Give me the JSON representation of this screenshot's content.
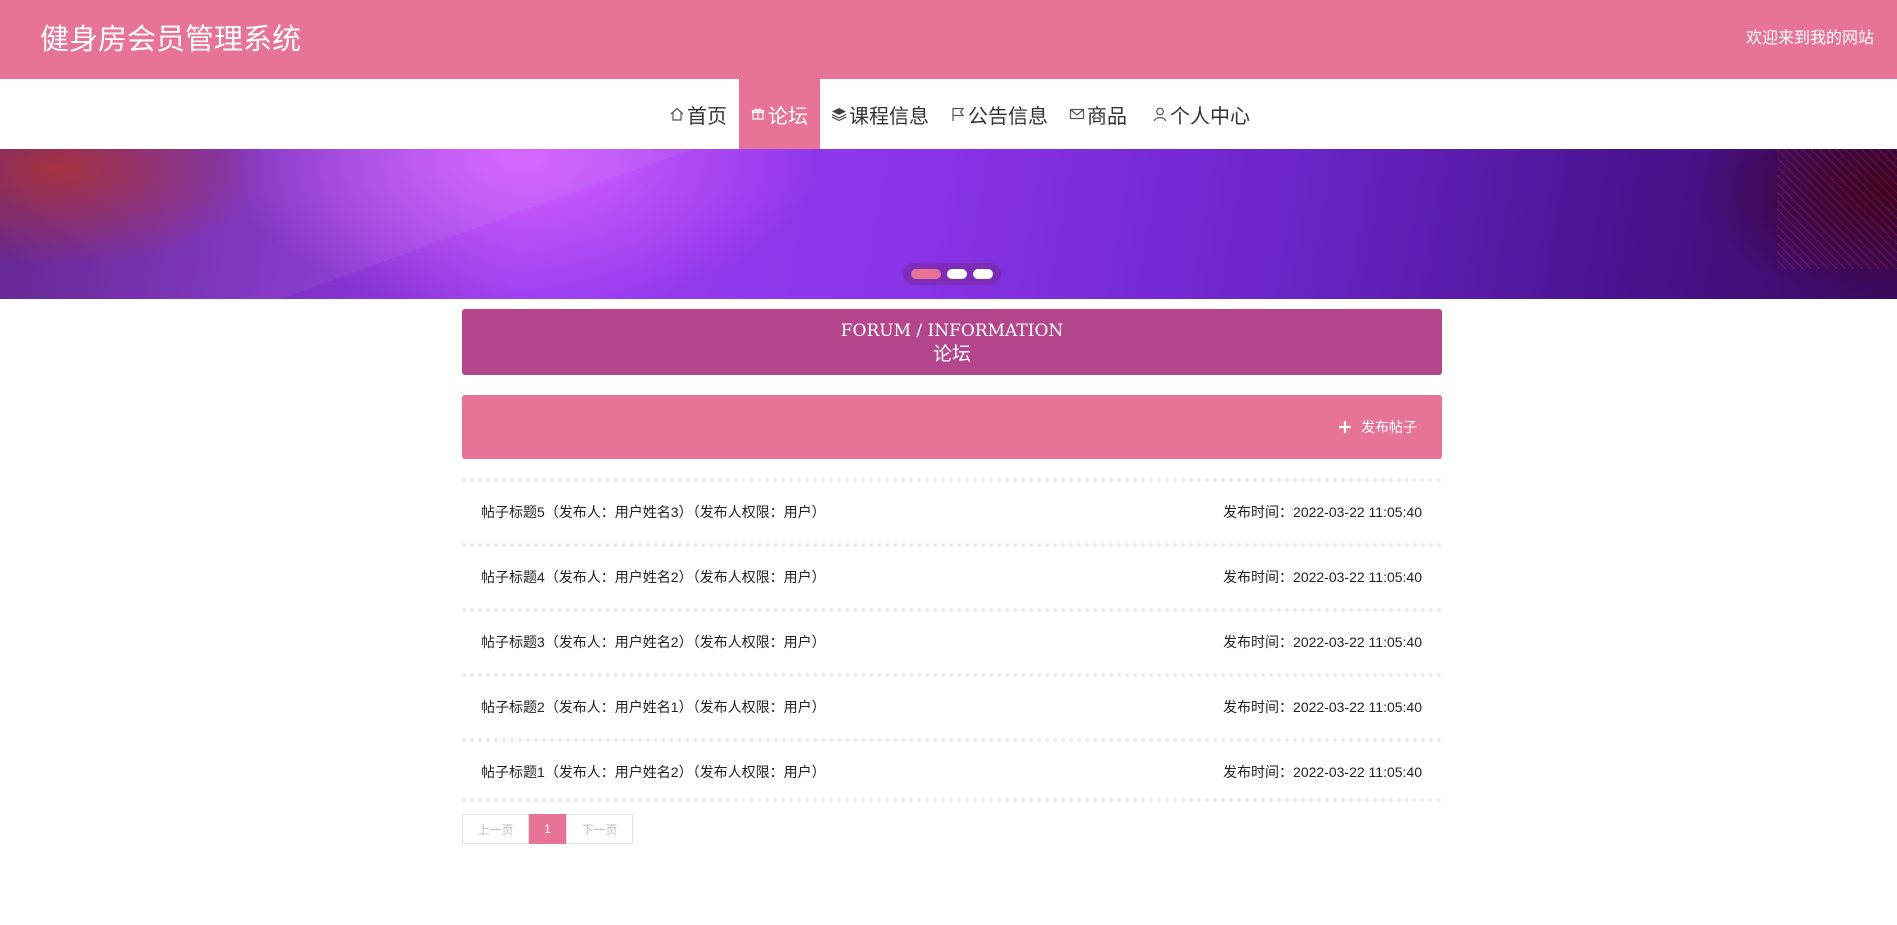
{
  "header": {
    "site_title": "健身房会员管理系统",
    "welcome": "欢迎来到我的网站",
    "bg_color": "#e77496"
  },
  "nav": {
    "items": [
      {
        "label": "首页",
        "icon": "home-icon",
        "active": false
      },
      {
        "label": "论坛",
        "icon": "gift-icon",
        "active": true
      },
      {
        "label": "课程信息",
        "icon": "layers-icon",
        "active": false
      },
      {
        "label": "公告信息",
        "icon": "flag-icon",
        "active": false
      },
      {
        "label": "商品",
        "icon": "mail-icon",
        "active": false
      },
      {
        "label": "个人中心",
        "icon": "user-icon",
        "active": false
      }
    ]
  },
  "banner": {
    "slide_count": 3,
    "active_slide": 1
  },
  "section": {
    "title_en": "FORUM / INFORMATION",
    "title_cn": "论坛",
    "bg_color": "#b4468e"
  },
  "actions": {
    "post_label": "发布帖子"
  },
  "posts": [
    {
      "title": "帖子标题5（发布人：用户姓名3）（发布人权限：用户）",
      "time": "发布时间：2022-03-22 11:05:40"
    },
    {
      "title": "帖子标题4（发布人：用户姓名2）（发布人权限：用户）",
      "time": "发布时间：2022-03-22 11:05:40"
    },
    {
      "title": "帖子标题3（发布人：用户姓名2）（发布人权限：用户）",
      "time": "发布时间：2022-03-22 11:05:40"
    },
    {
      "title": "帖子标题2（发布人：用户姓名1）（发布人权限：用户）",
      "time": "发布时间：2022-03-22 11:05:40"
    },
    {
      "title": "帖子标题1（发布人：用户姓名2）（发布人权限：用户）",
      "time": "发布时间：2022-03-22 11:05:40"
    }
  ],
  "pagination": {
    "prev_label": "上一页",
    "current_page": "1",
    "next_label": "下一页"
  }
}
